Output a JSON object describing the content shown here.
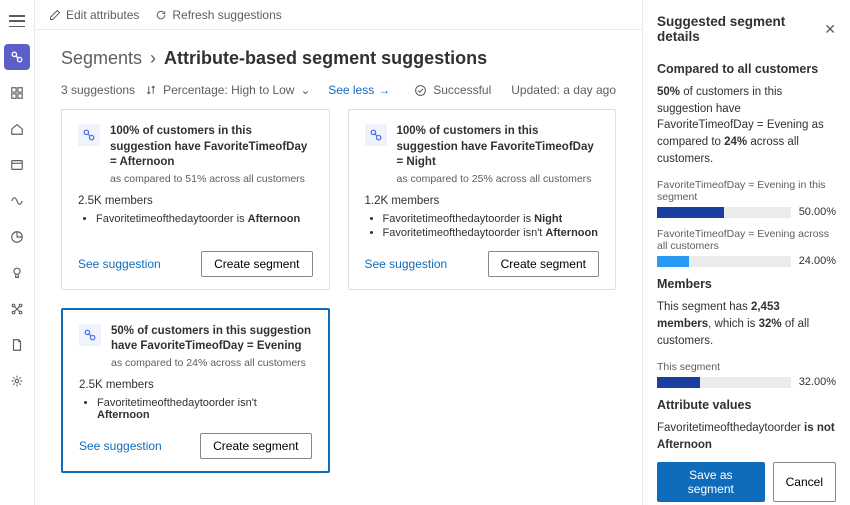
{
  "cmdbar": {
    "edit": "Edit attributes",
    "refresh": "Refresh suggestions"
  },
  "breadcrumb": {
    "root": "Segments",
    "sep": "›",
    "current": "Attribute-based segment suggestions"
  },
  "listhead": {
    "count": "3 suggestions",
    "sort": "Percentage: High to Low",
    "seeless": "See less",
    "status": "Successful",
    "updated": "Updated: a day ago"
  },
  "cards": [
    {
      "title": "100% of customers in this suggestion have FavoriteTimeofDay = Afternoon",
      "sub": "as compared to 51% across all customers",
      "members": "2.5K members",
      "bullets": [
        {
          "pre": "Favoritetimeofthedaytoorder is ",
          "bold": "Afternoon"
        }
      ]
    },
    {
      "title": "100% of customers in this suggestion have FavoriteTimeofDay = Night",
      "sub": "as compared to 25% across all customers",
      "members": "1.2K members",
      "bullets": [
        {
          "pre": "Favoritetimeofthedaytoorder is ",
          "bold": "Night"
        },
        {
          "pre": "Favoritetimeofthedaytoorder isn't ",
          "bold": "Afternoon"
        }
      ]
    },
    {
      "title": "50% of customers in this suggestion have FavoriteTimeofDay = Evening",
      "sub": "as compared to 24% across all customers",
      "members": "2.5K members",
      "bullets": [
        {
          "pre": "Favoritetimeofthedaytoorder isn't ",
          "bold": "Afternoon"
        }
      ],
      "selected": true
    }
  ],
  "cardaction": {
    "see": "See suggestion",
    "create": "Create segment"
  },
  "panel": {
    "title": "Suggested segment details",
    "comparedHeader": "Compared to all customers",
    "comparedText1": "50%",
    "comparedText2": " of customers in this suggestion have FavoriteTimeofDay = Evening as compared to ",
    "comparedText3": "24%",
    "comparedText4": " across all customers.",
    "bar1Label": "FavoriteTimeofDay = Evening in this segment",
    "bar1Pct": "50.00%",
    "bar1W": 50,
    "bar2Label": "FavoriteTimeofDay = Evening across all customers",
    "bar2Pct": "24.00%",
    "bar2W": 24,
    "membersHeader": "Members",
    "membersText1": "This segment has ",
    "membersText2": "2,453 members",
    "membersText3": ", which is ",
    "membersText4": "32%",
    "membersText5": " of all customers.",
    "bar3Label": "This segment",
    "bar3Pct": "32.00%",
    "bar3W": 32,
    "attrHeader": "Attribute values",
    "attrText1": "Favoritetimeofthedaytoorder ",
    "attrText2": "is not Afternoon",
    "save": "Save as segment",
    "cancel": "Cancel"
  }
}
